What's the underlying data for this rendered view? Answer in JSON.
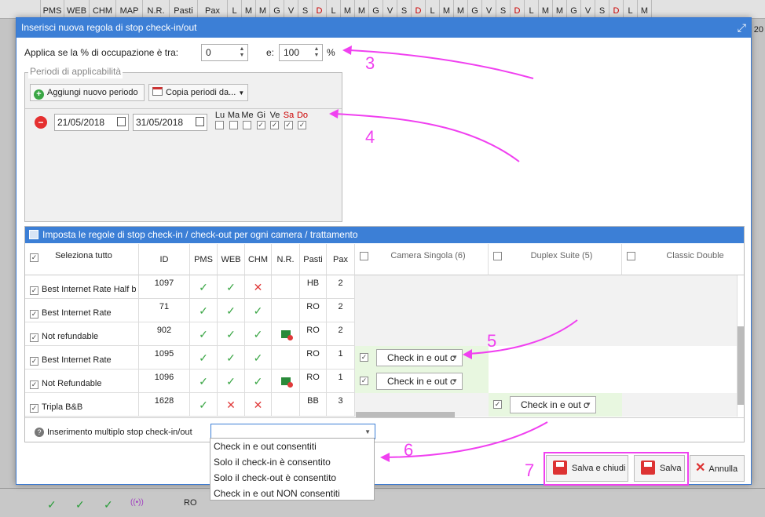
{
  "background": {
    "columns": [
      "PMS",
      "WEB",
      "CHM",
      "MAP",
      "N.R.",
      "Pasti",
      "Pax",
      "L",
      "M",
      "M",
      "G",
      "V",
      "S",
      "D",
      "L",
      "M",
      "M",
      "G",
      "V",
      "S",
      "D",
      "L",
      "M",
      "M",
      "G",
      "V",
      "S",
      "D",
      "L",
      "M",
      "M",
      "G",
      "V",
      "S",
      "D",
      "L",
      "M"
    ],
    "corner": "20",
    "bottom_row_value": "RO"
  },
  "dialog": {
    "title": "Inserisci nuova regola di stop check-in/out",
    "occupancy": {
      "label": "Applica se la % di occupazione è tra:",
      "from": "0",
      "and_label": "e:",
      "to": "100",
      "unit": "%"
    },
    "periods": {
      "legend": "Periodi di applicabilità",
      "add_label": "Aggiungi nuovo periodo",
      "copy_label": "Copia periodi da...",
      "start": "21/05/2018",
      "end": "31/05/2018",
      "days": [
        {
          "label": "Lu",
          "checked": false,
          "weekend": false
        },
        {
          "label": "Ma",
          "checked": false,
          "weekend": false
        },
        {
          "label": "Me",
          "checked": false,
          "weekend": false
        },
        {
          "label": "Gi",
          "checked": true,
          "weekend": false
        },
        {
          "label": "Ve",
          "checked": true,
          "weekend": false
        },
        {
          "label": "Sa",
          "checked": true,
          "weekend": true
        },
        {
          "label": "Do",
          "checked": true,
          "weekend": true
        }
      ]
    },
    "rules": {
      "title": "Imposta le regole di stop check-in / check-out per ogni camera / trattamento",
      "select_all": "Seleziona tutto",
      "columns": [
        "ID",
        "PMS",
        "WEB",
        "CHM",
        "N.R.",
        "Pasti",
        "Pax"
      ],
      "rooms": [
        "Camera Singola (6)",
        "Duplex Suite (5)",
        "Classic Double"
      ],
      "rows": [
        {
          "name": "Best Internet Rate Half b",
          "id": "1097",
          "pms": "ok",
          "web": "ok",
          "chm": "ko",
          "nr": false,
          "pasti": "HB",
          "pax": "2"
        },
        {
          "name": "Best Internet Rate",
          "id": "71",
          "pms": "ok",
          "web": "ok",
          "chm": "ok",
          "nr": false,
          "pasti": "RO",
          "pax": "2"
        },
        {
          "name": "Not refundable",
          "id": "902",
          "pms": "ok",
          "web": "ok",
          "chm": "ok",
          "nr": true,
          "pasti": "RO",
          "pax": "2"
        },
        {
          "name": "Best Internet Rate",
          "id": "1095",
          "pms": "ok",
          "web": "ok",
          "chm": "ok",
          "nr": false,
          "pasti": "RO",
          "pax": "1"
        },
        {
          "name": "Not Refundable",
          "id": "1096",
          "pms": "ok",
          "web": "ok",
          "chm": "ok",
          "nr": true,
          "pasti": "RO",
          "pax": "1"
        },
        {
          "name": "Tripla B&B",
          "id": "1628",
          "pms": "ok",
          "web": "ko",
          "chm": "ko",
          "nr": false,
          "pasti": "BB",
          "pax": "3"
        }
      ],
      "room_select_value": "Check in e out c"
    },
    "multi": {
      "label": "Inserimento multiplo stop check-in/out",
      "value": "",
      "options": [
        "Check in e out consentiti",
        "Solo il check-in è consentito",
        "Solo il check-out è consentito",
        "Check in e out NON consentiti"
      ]
    },
    "actions": {
      "save_close": "Salva e chiudi",
      "save": "Salva",
      "cancel": "Annulla"
    }
  },
  "annotations": [
    "3",
    "4",
    "5",
    "6",
    "7"
  ],
  "colors": {
    "accent": "#3c7fd6",
    "annotation": "#f040f0",
    "ok": "#3aa645",
    "ko": "#e03a3a"
  }
}
